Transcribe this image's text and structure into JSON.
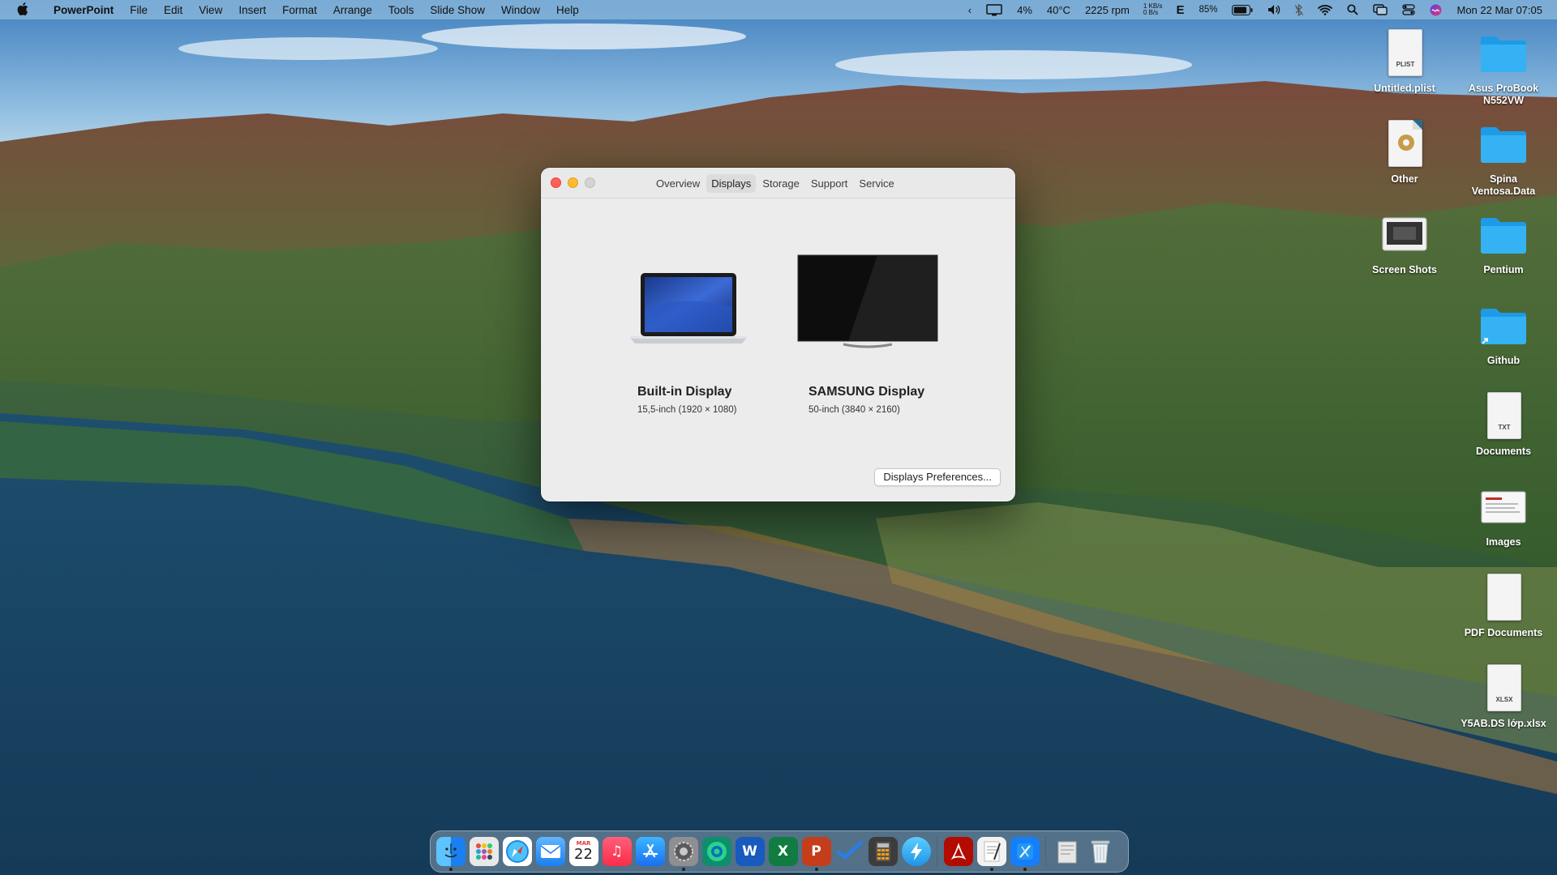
{
  "menubar": {
    "apple_icon": "apple-icon",
    "app_name": "PowerPoint",
    "menus": [
      "File",
      "Edit",
      "View",
      "Insert",
      "Format",
      "Arrange",
      "Tools",
      "Slide Show",
      "Window",
      "Help"
    ],
    "status": {
      "cpu": "4%",
      "temperature": "40°C",
      "fan": "2225 rpm",
      "net_up": "1 KB/s",
      "net_down": "0 B/s",
      "input_source": "E",
      "battery": "85%",
      "clock": "Mon 22 Mar  07:05"
    }
  },
  "desktop": {
    "icons": [
      {
        "label": "Untitled.plist",
        "kind": "doc",
        "tag": "PLIST"
      },
      {
        "label": "Asus ProBook N552VW",
        "kind": "folder"
      },
      {
        "label": "Other",
        "kind": "doc",
        "tag": ""
      },
      {
        "label": "Spina Ventosa.Data",
        "kind": "folder"
      },
      {
        "label": "Screen Shots",
        "kind": "doc",
        "tag": ""
      },
      {
        "label": "Pentium",
        "kind": "folder"
      },
      {
        "label": "Github",
        "kind": "folder"
      },
      {
        "label": "Documents",
        "kind": "doc",
        "tag": "TXT"
      },
      {
        "label": "Images",
        "kind": "doc",
        "tag": ""
      },
      {
        "label": "PDF Documents",
        "kind": "doc",
        "tag": ""
      },
      {
        "label": "Y5AB.DS lớp.xlsx",
        "kind": "doc",
        "tag": "XLSX"
      }
    ]
  },
  "about_window": {
    "tabs": [
      "Overview",
      "Displays",
      "Storage",
      "Support",
      "Service"
    ],
    "active_tab": "Displays",
    "displays": [
      {
        "name": "Built-in Display",
        "spec": "15,5-inch (1920 × 1080)"
      },
      {
        "name": "SAMSUNG Display",
        "spec": "50-inch (3840 × 2160)"
      }
    ],
    "preferences_button": "Displays Preferences..."
  },
  "dock": {
    "calendar_month": "MAR",
    "calendar_day": "22",
    "apps": [
      {
        "name": "Finder",
        "color": "#2d8cf0"
      },
      {
        "name": "Launchpad",
        "color": "#e8e8e8"
      },
      {
        "name": "Safari",
        "color": "#1e88e5"
      },
      {
        "name": "Mail",
        "color": "#3f9bf7"
      },
      {
        "name": "Calendar",
        "color": "#ffffff"
      },
      {
        "name": "Music",
        "color": "#fa2d48"
      },
      {
        "name": "App Store",
        "color": "#1a8cff"
      },
      {
        "name": "System Preferences",
        "color": "#8e8e93"
      },
      {
        "name": "Edge Dev",
        "color": "#0f8e6b"
      },
      {
        "name": "Word",
        "color": "#185abd"
      },
      {
        "name": "Excel",
        "color": "#107c41"
      },
      {
        "name": "PowerPoint",
        "color": "#c43e1c"
      },
      {
        "name": "Visual Studio",
        "color": "#2d7de0"
      },
      {
        "name": "Calculator",
        "color": "#3c3c3c"
      },
      {
        "name": "Reeder",
        "color": "#2aa5f0"
      },
      {
        "name": "Acrobat",
        "color": "#b30b00"
      },
      {
        "name": "TextEdit",
        "color": "#f2f2f2"
      },
      {
        "name": "Xcode",
        "color": "#147efb"
      },
      {
        "name": "Downloads",
        "color": "#dcdcdc"
      },
      {
        "name": "Trash",
        "color": "#cfd8dc"
      }
    ]
  }
}
